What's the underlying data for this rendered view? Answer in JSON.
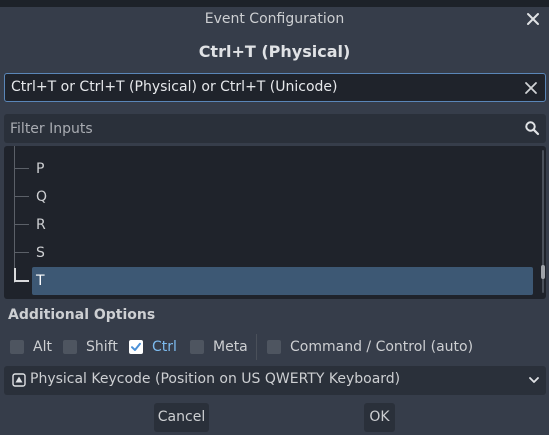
{
  "window": {
    "title": "Event Configuration",
    "event_title": "Ctrl+T (Physical)"
  },
  "listen_field": {
    "value": "Ctrl+T or Ctrl+T (Physical) or Ctrl+T (Unicode)"
  },
  "filter": {
    "placeholder": "Filter Inputs"
  },
  "tree": {
    "items": [
      {
        "label": "P",
        "selected": false
      },
      {
        "label": "Q",
        "selected": false
      },
      {
        "label": "R",
        "selected": false
      },
      {
        "label": "S",
        "selected": false
      },
      {
        "label": "T",
        "selected": true
      }
    ]
  },
  "options": {
    "section_label": "Additional Options",
    "modifiers": [
      {
        "label": "Alt",
        "checked": false
      },
      {
        "label": "Shift",
        "checked": false
      },
      {
        "label": "Ctrl",
        "checked": true
      },
      {
        "label": "Meta",
        "checked": false
      },
      {
        "label": "Command / Control (auto)",
        "checked": false
      }
    ]
  },
  "keycode_mode": {
    "selected": "Physical Keycode (Position on US QWERTY Keyboard)"
  },
  "buttons": {
    "cancel": "Cancel",
    "ok": "OK"
  },
  "colors": {
    "background": "#363d4a",
    "field": "#2a303a",
    "tree_bg": "#1f232b",
    "accent": "#7dbbef",
    "selection": "#3d5874"
  },
  "icons": {
    "close": "close-icon",
    "clear": "clear-icon",
    "search": "search-icon",
    "checkbox_checked": "check-icon",
    "keycode": "physical-key-icon",
    "dropdown": "chevron-down-icon"
  }
}
